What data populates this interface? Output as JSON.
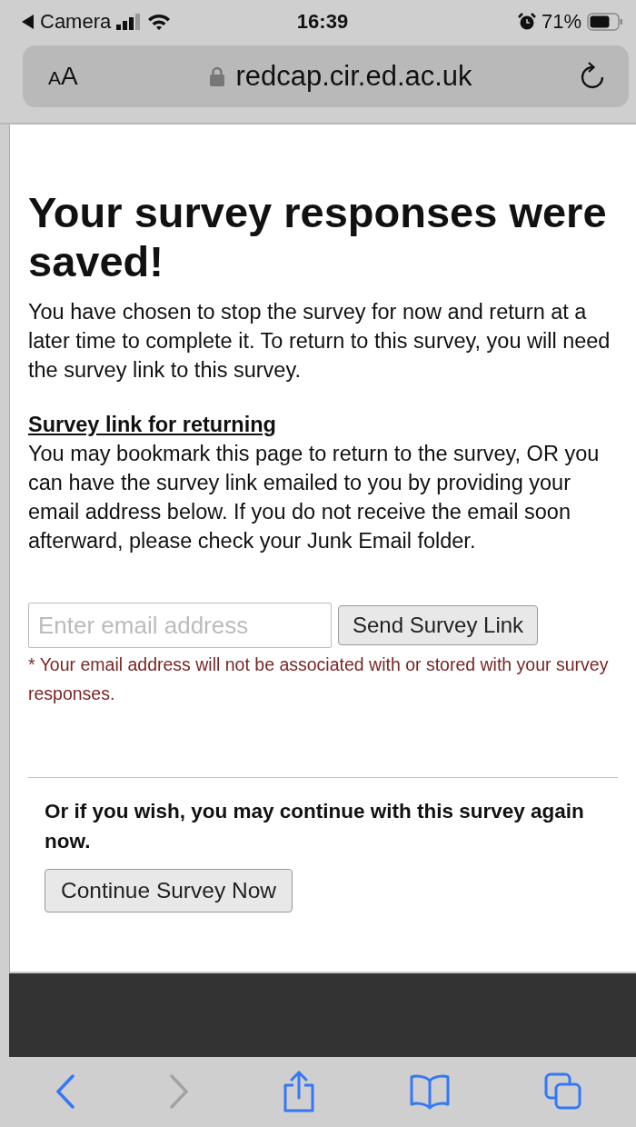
{
  "status_bar": {
    "back_app": "Camera",
    "time": "16:39",
    "battery": "71%"
  },
  "url_bar": {
    "text_size": "AA",
    "address": "redcap.cir.ed.ac.uk"
  },
  "page": {
    "heading": "Your survey responses were saved!",
    "intro": "You have chosen to stop the survey for now and return at a later time to complete it. To return to this survey, you will need the survey link to this survey.",
    "link_heading": "Survey link for returning",
    "link_text": "You may bookmark this page to return to the survey, OR you can have the survey link emailed to you by providing your email address below. If you do not receive the email soon afterward, please check your Junk Email folder.",
    "email_field": {
      "placeholder": "Enter email address"
    },
    "send_button": "Send Survey Link",
    "note": "* Your email address will not be associated with or stored with your survey responses.",
    "continue_prompt": "Or if you wish, you may continue with this survey again now.",
    "continue_button": "Continue Survey Now"
  },
  "toolbar": [
    {
      "kind": "back",
      "disabled": false
    },
    {
      "kind": "forward",
      "disabled": true
    },
    {
      "kind": "share",
      "disabled": false
    },
    {
      "kind": "bookmarks",
      "disabled": false
    },
    {
      "kind": "tabs",
      "disabled": false
    }
  ]
}
